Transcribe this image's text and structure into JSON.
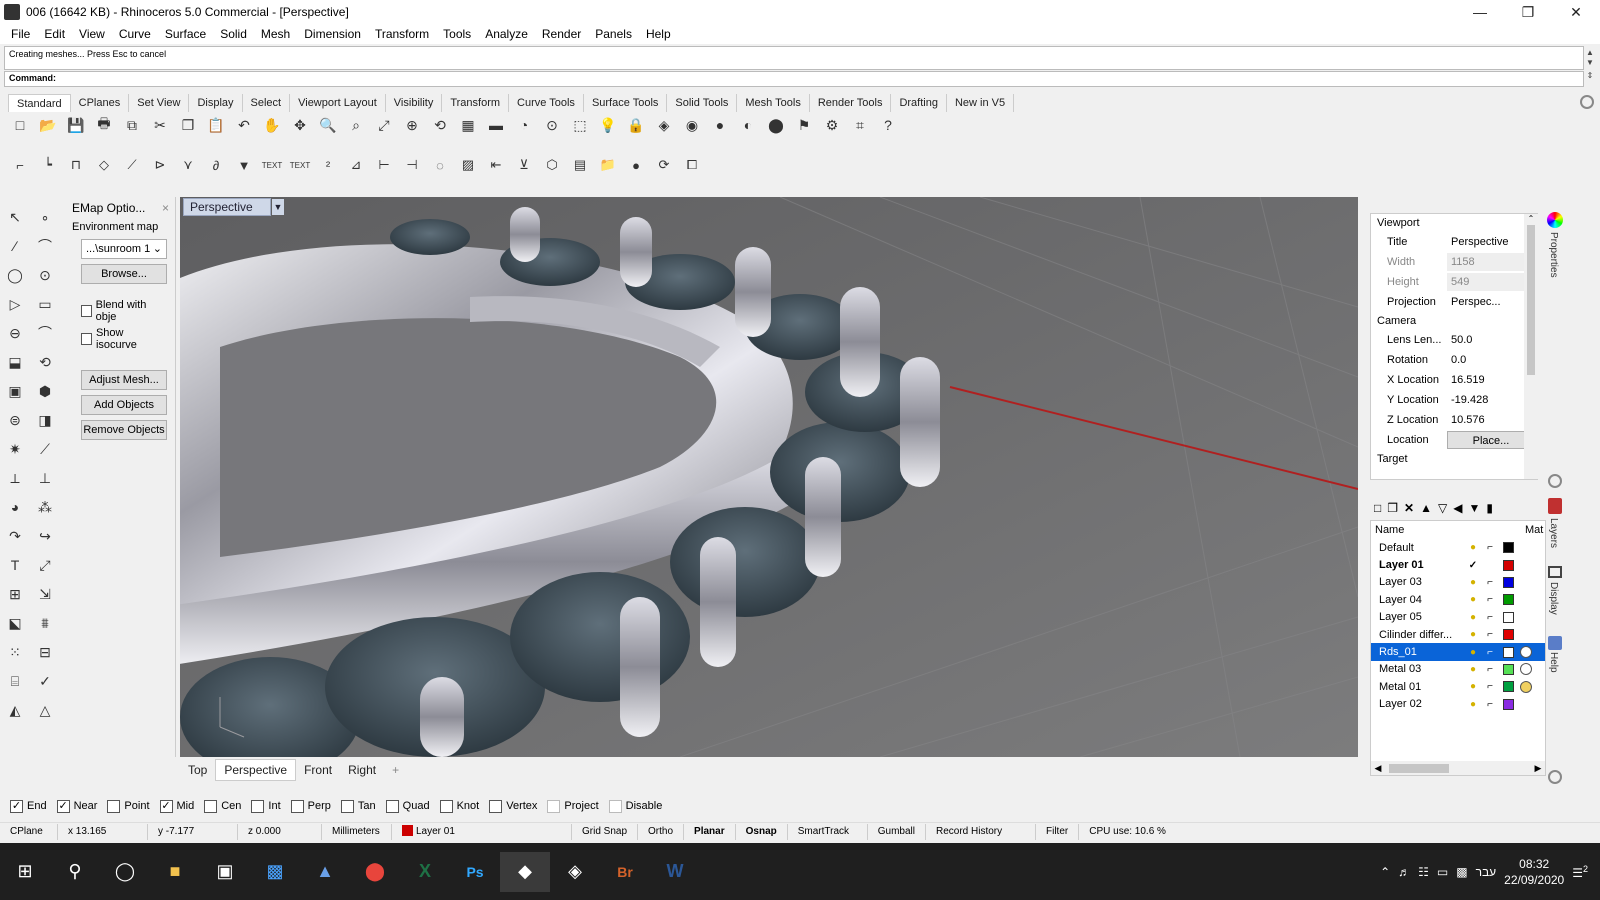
{
  "window": {
    "title": "006 (16642 KB) - Rhinoceros 5.0 Commercial - [Perspective]"
  },
  "menu": [
    "File",
    "Edit",
    "View",
    "Curve",
    "Surface",
    "Solid",
    "Mesh",
    "Dimension",
    "Transform",
    "Tools",
    "Analyze",
    "Render",
    "Panels",
    "Help"
  ],
  "command": {
    "history": "Creating meshes... Press Esc to cancel",
    "prompt": "Command:"
  },
  "toolbar_tabs": [
    "Standard",
    "CPlanes",
    "Set View",
    "Display",
    "Select",
    "Viewport Layout",
    "Visibility",
    "Transform",
    "Curve Tools",
    "Surface Tools",
    "Solid Tools",
    "Mesh Tools",
    "Render Tools",
    "Drafting",
    "New in V5"
  ],
  "toolbar_icons_row1": [
    "new-file-icon",
    "open-file-icon",
    "save-icon",
    "print-icon",
    "export-icon",
    "cut-icon",
    "copy-icon",
    "paste-icon",
    "undo-icon",
    "pan-hand-icon",
    "move-icon",
    "zoom-icon",
    "zoom-window-icon",
    "zoom-extents-icon",
    "zoom-selected-icon",
    "rotate-view-icon",
    "four-viewports-icon",
    "cplane-icon",
    "named-view-icon",
    "osnap-icon",
    "select-icon",
    "light-icon",
    "lock-icon",
    "material-icon",
    "color-wheel-icon",
    "shaded-icon",
    "rendered-icon",
    "render-sphere-icon",
    "filter-icon",
    "gear-options-icon",
    "mesh-tools-icon",
    "help-icon"
  ],
  "toolbar_icons_row1_glyphs": [
    "□",
    "📂",
    "💾",
    "🖶",
    "⧉",
    "✂",
    "❐",
    "📋",
    "↶",
    "✋",
    "✥",
    "🔍",
    "⌕",
    "⤢",
    "⊕",
    "⟲",
    "▦",
    "▬",
    "◔",
    "⊙",
    "⬚",
    "💡",
    "🔒",
    "◈",
    "◉",
    "●",
    "◐",
    "⬤",
    "⚑",
    "⚙",
    "⌗",
    "?"
  ],
  "toolbar_icons_row2_glyphs": [
    "⌐",
    "┕",
    "⊓",
    "◇",
    "⟋",
    "⊳",
    "⋎",
    "∂",
    "▼",
    "TEXT",
    "TEXT",
    "²",
    "⊿",
    "⊢",
    "⊣",
    "◌",
    "▨",
    "⇤",
    "⊻",
    "⬡",
    "▤",
    "📁",
    "●",
    "⟳",
    "⧠"
  ],
  "left_tools_glyphs": [
    "↖",
    "∘",
    "∕",
    "⌒",
    "◯",
    "⊙",
    "▷",
    "▭",
    "⊖",
    "⌒",
    "⬓",
    "⟲",
    "▣",
    "⬢",
    "⊜",
    "◨",
    "✷",
    "⟋",
    "⟂",
    "⊥",
    "◕",
    "⁂",
    "↷",
    "↪",
    "T",
    "⤢",
    "⊞",
    "⇲",
    "⬕",
    "⩩",
    "⁙",
    "⊟",
    "⌸",
    "✓",
    "◭",
    "△"
  ],
  "emap": {
    "title": "EMap Optio...",
    "env_label": "Environment map",
    "env_value": "...\\sunroom 1",
    "browse": "Browse...",
    "blend_label": "Blend with obje",
    "isocurve_label": "Show isocurve",
    "adjust_mesh": "Adjust Mesh...",
    "add_objects": "Add Objects",
    "remove_objects": "Remove Objects"
  },
  "viewport": {
    "active_title": "Perspective",
    "tabs": [
      "Top",
      "Perspective",
      "Front",
      "Right"
    ],
    "add_tab": "+"
  },
  "osnap": [
    {
      "label": "End",
      "checked": true
    },
    {
      "label": "Near",
      "checked": true
    },
    {
      "label": "Point",
      "checked": false
    },
    {
      "label": "Mid",
      "checked": true
    },
    {
      "label": "Cen",
      "checked": false
    },
    {
      "label": "Int",
      "checked": false
    },
    {
      "label": "Perp",
      "checked": false
    },
    {
      "label": "Tan",
      "checked": false
    },
    {
      "label": "Quad",
      "checked": false
    },
    {
      "label": "Knot",
      "checked": false
    },
    {
      "label": "Vertex",
      "checked": false
    },
    {
      "label": "Project",
      "checked": false
    },
    {
      "label": "Disable",
      "checked": false
    }
  ],
  "statusbar": {
    "cplane": "CPlane",
    "x": "x 13.165",
    "y": "y -7.177",
    "z": "z 0.000",
    "units": "Millimeters",
    "layer": "Layer 01",
    "grid_snap": "Grid Snap",
    "ortho": "Ortho",
    "planar": "Planar",
    "osnap": "Osnap",
    "smarttrack": "SmartTrack",
    "gumball": "Gumball",
    "record_history": "Record History",
    "filter": "Filter",
    "cpu": "CPU use: 10.6 %"
  },
  "properties": {
    "viewport_section": "Viewport",
    "title_label": "Title",
    "title_value": "Perspective",
    "width_label": "Width",
    "width_value": "1158",
    "height_label": "Height",
    "height_value": "549",
    "projection_label": "Projection",
    "projection_value": "Perspec...",
    "camera_section": "Camera",
    "lens_label": "Lens Len...",
    "lens_value": "50.0",
    "rotation_label": "Rotation",
    "rotation_value": "0.0",
    "xloc_label": "X Location",
    "xloc_value": "16.519",
    "yloc_label": "Y Location",
    "yloc_value": "-19.428",
    "zloc_label": "Z Location",
    "zloc_value": "10.576",
    "location_label": "Location",
    "location_btn": "Place...",
    "target_section": "Target"
  },
  "side_tabs": {
    "properties": "Properties",
    "layers": "Layers",
    "display": "Display",
    "help": "Help"
  },
  "layers": {
    "col_name": "Name",
    "col_mat": "Mat",
    "rows": [
      {
        "name": "Default",
        "color": "#000000",
        "current": false
      },
      {
        "name": "Layer 01",
        "color": "#d40000",
        "current": true
      },
      {
        "name": "Layer 03",
        "color": "#0000e0",
        "current": false
      },
      {
        "name": "Layer 04",
        "color": "#009a00",
        "current": false
      },
      {
        "name": "Layer 05",
        "color": "#ffffff",
        "current": false
      },
      {
        "name": "Cilinder differ...",
        "color": "#e00000",
        "current": false
      },
      {
        "name": "Rds_01",
        "color": "#ffffff",
        "current": false,
        "selected": true
      },
      {
        "name": "Metal 03",
        "color": "#55e055",
        "current": false
      },
      {
        "name": "Metal 01",
        "color": "#00a040",
        "current": false
      },
      {
        "name": "Layer 02",
        "color": "#8a2be2",
        "current": false
      }
    ]
  },
  "taskbar": {
    "time": "08:32",
    "date": "22/09/2020",
    "lang": "עבר",
    "notif": "2"
  }
}
